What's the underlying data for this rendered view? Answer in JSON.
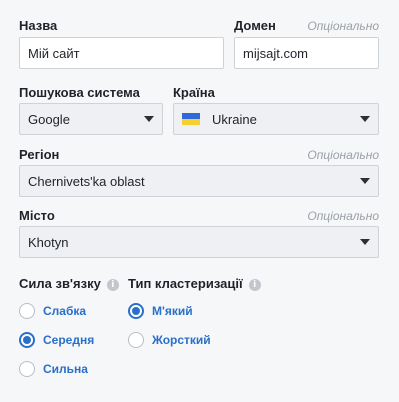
{
  "name": {
    "label": "Назва",
    "value": "Мій сайт"
  },
  "domain": {
    "label": "Домен",
    "optional": "Опціонально",
    "value": "mijsajt.com"
  },
  "search_engine": {
    "label": "Пошукова система",
    "value": "Google"
  },
  "country": {
    "label": "Країна",
    "value": "Ukraine",
    "flag_colors": [
      "#2f6bd6",
      "#f6d02f"
    ]
  },
  "region": {
    "label": "Регіон",
    "optional": "Опціонально",
    "value": "Chernivets'ka oblast"
  },
  "city": {
    "label": "Місто",
    "optional": "Опціонально",
    "value": "Khotyn"
  },
  "link_strength": {
    "label": "Сила зв'язку",
    "info_icon": "info-icon",
    "options": [
      {
        "label": "Слабка",
        "checked": false
      },
      {
        "label": "Середня",
        "checked": true
      },
      {
        "label": "Сильна",
        "checked": false
      }
    ]
  },
  "clustering_type": {
    "label": "Тип кластеризації",
    "info_icon": "info-icon",
    "options": [
      {
        "label": "М'який",
        "checked": true
      },
      {
        "label": "Жорсткий",
        "checked": false
      }
    ]
  },
  "colors": {
    "accent": "#2a6fc9",
    "optional_text": "#9aa0a6"
  }
}
